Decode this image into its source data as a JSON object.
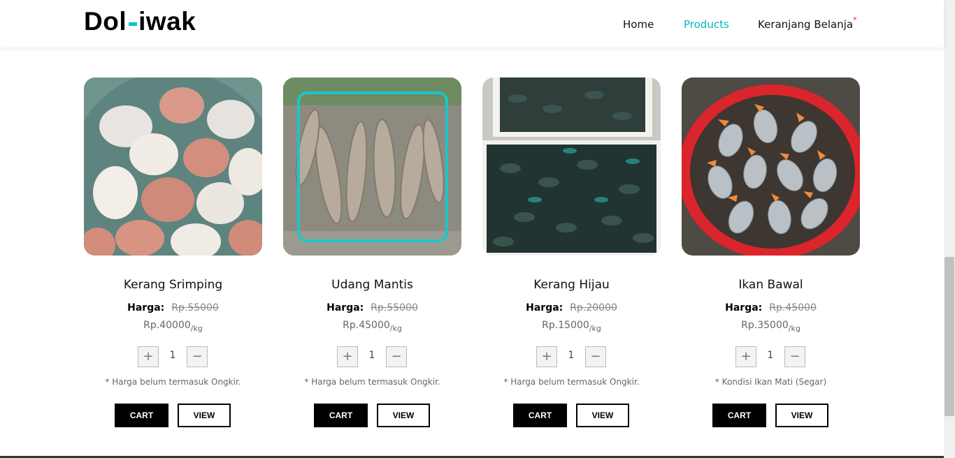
{
  "header": {
    "logo_left": "Dol",
    "logo_right": "iwak",
    "nav": [
      {
        "label": "Home",
        "active": false
      },
      {
        "label": "Products",
        "active": true
      },
      {
        "label": "Keranjang Belanja",
        "active": false,
        "marker": "*"
      }
    ],
    "accent_color": "#00c3cf"
  },
  "products": [
    {
      "name": "Kerang Srimping",
      "price_label": "Harga:",
      "old_price": "Rp.55000",
      "new_price": "Rp.40000",
      "unit": "/kg",
      "quantity": "1",
      "note": "* Harga belum termasuk Ongkir.",
      "cart_label": "CART",
      "view_label": "VIEW",
      "plus_symbol": "+",
      "minus_symbol": "−",
      "image": "scallop-shells-photo"
    },
    {
      "name": "Udang Mantis",
      "price_label": "Harga:",
      "old_price": "Rp.55000",
      "new_price": "Rp.45000",
      "unit": "/kg",
      "quantity": "1",
      "note": "* Harga belum termasuk Ongkir.",
      "cart_label": "CART",
      "view_label": "VIEW",
      "plus_symbol": "+",
      "minus_symbol": "−",
      "image": "mantis-shrimp-photo"
    },
    {
      "name": "Kerang Hijau",
      "price_label": "Harga:",
      "old_price": "Rp.20000",
      "new_price": "Rp.15000",
      "unit": "/kg",
      "quantity": "1",
      "note": "* Harga belum termasuk Ongkir.",
      "cart_label": "CART",
      "view_label": "VIEW",
      "plus_symbol": "+",
      "minus_symbol": "−",
      "image": "green-mussels-photo"
    },
    {
      "name": "Ikan Bawal",
      "price_label": "Harga:",
      "old_price": "Rp.45000",
      "new_price": "Rp.35000",
      "unit": "/kg",
      "quantity": "1",
      "note": "* Kondisi Ikan Mati (Segar)",
      "cart_label": "CART",
      "view_label": "VIEW",
      "plus_symbol": "+",
      "minus_symbol": "−",
      "image": "pomfret-fish-photo"
    }
  ]
}
